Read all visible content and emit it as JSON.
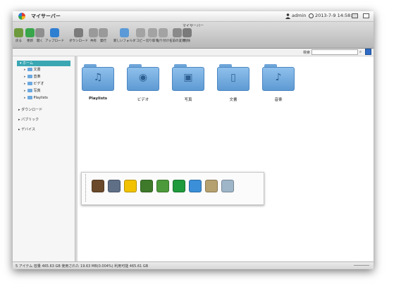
{
  "titlebar": {
    "app_title": "マイサーバー",
    "user": "admin",
    "datetime": "2013-7-9 14:58:33"
  },
  "toolbar": {
    "title": "マイサーバー",
    "buttons": [
      {
        "id": "back",
        "label": "戻る",
        "icon": "back-arrow",
        "color": "#6d9a3c"
      },
      {
        "id": "refresh",
        "label": "更新",
        "icon": "refresh",
        "color": "#3aa64b"
      },
      {
        "id": "open",
        "label": "開く",
        "icon": "open-folder",
        "color": "#8f8f8f"
      },
      {
        "id": "upload",
        "label": "アップロード",
        "icon": "globe-upload",
        "color": "#2f7fd1"
      },
      {
        "id": "download",
        "label": "ダウンロード",
        "icon": "download",
        "color": "#7c7c7c"
      },
      {
        "id": "share",
        "label": "共有",
        "icon": "share",
        "color": "#9a9a9a"
      },
      {
        "id": "publish",
        "label": "発行",
        "icon": "publish",
        "color": "#9a9a9a"
      },
      {
        "id": "new-folder",
        "label": "新しいフォルダ",
        "icon": "new-folder",
        "color": "#5b9ad6"
      },
      {
        "id": "copy",
        "label": "コピー",
        "icon": "copy",
        "color": "#a3a3a3"
      },
      {
        "id": "cut",
        "label": "切り取り",
        "icon": "scissors",
        "color": "#a3a3a3"
      },
      {
        "id": "paste",
        "label": "貼り付け",
        "icon": "paste",
        "color": "#a3a3a3"
      },
      {
        "id": "rename",
        "label": "名前の変更",
        "icon": "rename",
        "color": "#8a8a8a"
      },
      {
        "id": "delete",
        "label": "削除",
        "icon": "delete",
        "color": "#7a7a7a"
      }
    ]
  },
  "search": {
    "label": "検索",
    "placeholder": ""
  },
  "sidebar": {
    "home": "ホーム",
    "children": [
      "文書",
      "音楽",
      "ビデオ",
      "写真",
      "Playlists"
    ],
    "top_items": [
      "ダウンロード",
      "パブリック",
      "デバイス"
    ]
  },
  "folders": [
    {
      "label": "Playlists",
      "icon": "playlist-icon",
      "glyph": "♫",
      "bold": true
    },
    {
      "label": "ビデオ",
      "icon": "film-reel-icon",
      "glyph": "◉",
      "bold": false
    },
    {
      "label": "写真",
      "icon": "photo-icon",
      "glyph": "▣",
      "bold": false
    },
    {
      "label": "文書",
      "icon": "document-icon",
      "glyph": "▯",
      "bold": false
    },
    {
      "label": "音楽",
      "icon": "music-note-icon",
      "glyph": "♪",
      "bold": false
    }
  ],
  "dock": {
    "apps": [
      {
        "name": "home-app",
        "color": "#6b4a2b"
      },
      {
        "name": "gallery-app",
        "color": "#5f6f86"
      },
      {
        "name": "media-player-app",
        "color": "#f2c200"
      },
      {
        "name": "contacts-app",
        "color": "#3e7a2a"
      },
      {
        "name": "web-browser-app",
        "color": "#4c9a3b"
      },
      {
        "name": "sync-app",
        "color": "#1f9a3c"
      },
      {
        "name": "network-app",
        "color": "#3a8fd8"
      },
      {
        "name": "editor-app",
        "color": "#b5a06f"
      },
      {
        "name": "disk-app",
        "color": "#9fb6c8"
      }
    ]
  },
  "status": {
    "text": "5 アイテム  容量 465.63 GB  使用された 19.63 MB(0.004%)  利用可能 465.61 GB"
  },
  "colors": {
    "home_highlight": "#3aa7b3",
    "folder_blue": "#6ea5d9"
  }
}
